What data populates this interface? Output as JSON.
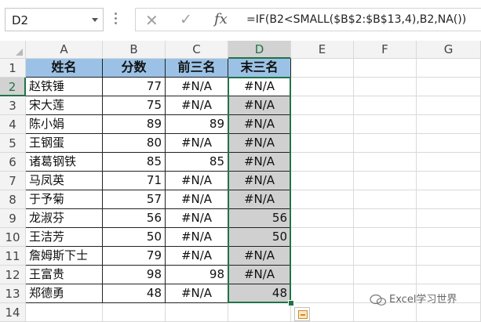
{
  "formula_bar": {
    "name_box": "D2",
    "cancel_glyph": "✕",
    "enter_glyph": "✓",
    "fx_label": "fx",
    "formula": "=IF(B2<SMALL($B$2:$B$13,4),B2,NA())"
  },
  "sheet": {
    "columns": [
      "A",
      "B",
      "C",
      "D",
      "E",
      "F",
      "G"
    ],
    "row_numbers": [
      "1",
      "2",
      "3",
      "4",
      "5",
      "6",
      "7",
      "8",
      "9",
      "10",
      "11",
      "12",
      "13",
      "14"
    ],
    "headers": [
      "姓名",
      "分数",
      "前三名",
      "末三名"
    ],
    "rows": [
      {
        "name": "赵铁锤",
        "score": "77",
        "top3": "#N/A",
        "bottom3": "#N/A"
      },
      {
        "name": "宋大莲",
        "score": "75",
        "top3": "#N/A",
        "bottom3": "#N/A"
      },
      {
        "name": "陈小娟",
        "score": "89",
        "top3": "89",
        "bottom3": "#N/A"
      },
      {
        "name": "王钢蛋",
        "score": "80",
        "top3": "#N/A",
        "bottom3": "#N/A"
      },
      {
        "name": "诸葛钢铁",
        "score": "85",
        "top3": "85",
        "bottom3": "#N/A"
      },
      {
        "name": "马凤英",
        "score": "71",
        "top3": "#N/A",
        "bottom3": "#N/A"
      },
      {
        "name": "于予菊",
        "score": "57",
        "top3": "#N/A",
        "bottom3": "#N/A"
      },
      {
        "name": "龙淑芬",
        "score": "56",
        "top3": "#N/A",
        "bottom3": "56"
      },
      {
        "name": "王洁芳",
        "score": "50",
        "top3": "#N/A",
        "bottom3": "50"
      },
      {
        "name": "詹姆斯下士",
        "score": "79",
        "top3": "#N/A",
        "bottom3": "#N/A"
      },
      {
        "name": "王富贵",
        "score": "98",
        "top3": "98",
        "bottom3": "#N/A"
      },
      {
        "name": "郑德勇",
        "score": "48",
        "top3": "#N/A",
        "bottom3": "48"
      }
    ],
    "selected_cell": "D2",
    "selected_column": "D",
    "selected_row": "2"
  },
  "watermark": {
    "text": "Excel学习世界"
  },
  "colors": {
    "header_fill": "#9bc2e6",
    "selection": "#217346",
    "highlight": "#d0d0d0"
  }
}
